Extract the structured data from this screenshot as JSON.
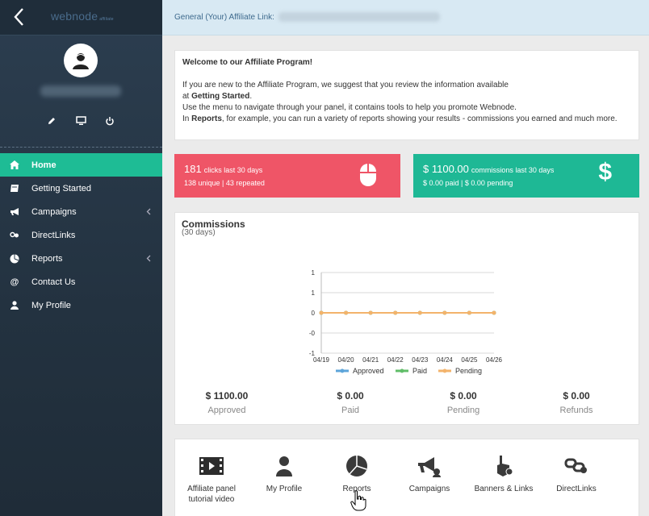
{
  "sidebar": {
    "logo": "webnode",
    "logo_sub": "affiliate",
    "items": [
      {
        "label": "Home",
        "icon": "home-icon",
        "active": true
      },
      {
        "label": "Getting Started",
        "icon": "book-icon"
      },
      {
        "label": "Campaigns",
        "icon": "bullhorn-icon",
        "submenu": true
      },
      {
        "label": "DirectLinks",
        "icon": "link-icon"
      },
      {
        "label": "Reports",
        "icon": "pie-chart-icon",
        "submenu": true
      },
      {
        "label": "Contact Us",
        "icon": "at-icon"
      },
      {
        "label": "My Profile",
        "icon": "user-icon"
      }
    ]
  },
  "header": {
    "affiliate_link_label": "General (Your) Affiliate Link:"
  },
  "welcome": {
    "title": "Welcome to our Affiliate Program!",
    "line1": "If you are new to the Affiliate Program, we suggest that you review the information available",
    "line2_prefix": "at ",
    "line2_bold": "Getting Started",
    "line2_suffix": ".",
    "line3": "Use the menu to navigate through your panel, it contains tools to help you promote Webnode.",
    "line4_prefix": "In ",
    "line4_bold": "Reports",
    "line4_suffix": ", for example, you can run a variety of reports showing your results - commissions you earned and much more."
  },
  "stats": {
    "clicks": {
      "value": "181",
      "label": "clicks last 30 days",
      "sub": "138 unique | 43 repeated",
      "color": "#ef5567"
    },
    "commissions": {
      "value": "$ 1100.00",
      "label": "commissions last 30 days",
      "sub": "$ 0.00 paid | $ 0.00 pending",
      "color": "#1eb895"
    }
  },
  "commissions": {
    "title": "Commissions",
    "subtitle": "(30 days)",
    "totals": [
      {
        "value": "$ 1100.00",
        "label": "Approved"
      },
      {
        "value": "$ 0.00",
        "label": "Paid"
      },
      {
        "value": "$ 0.00",
        "label": "Pending"
      },
      {
        "value": "$ 0.00",
        "label": "Refunds"
      }
    ]
  },
  "chart_data": {
    "type": "line",
    "categories": [
      "04/19",
      "04/20",
      "04/21",
      "04/22",
      "04/23",
      "04/24",
      "04/25",
      "04/26"
    ],
    "ylim": [
      -1,
      1
    ],
    "yticks": [
      "1",
      "1",
      "0",
      "-0",
      "-1"
    ],
    "series": [
      {
        "name": "Approved",
        "values": [
          0,
          0,
          0,
          0,
          0,
          0,
          0,
          0
        ],
        "color": "#5da5da"
      },
      {
        "name": "Paid",
        "values": [
          0,
          0,
          0,
          0,
          0,
          0,
          0,
          0
        ],
        "color": "#60bd68"
      },
      {
        "name": "Pending",
        "values": [
          0,
          0,
          0,
          0,
          0,
          0,
          0,
          0
        ],
        "color": "#f3b36b"
      }
    ],
    "legend": "bottom",
    "grid": true
  },
  "shortcuts": [
    {
      "label": "Affiliate panel tutorial video",
      "icon": "video-icon"
    },
    {
      "label": "My Profile",
      "icon": "user-icon"
    },
    {
      "label": "Reports",
      "icon": "pie-chart-icon"
    },
    {
      "label": "Campaigns",
      "icon": "bullhorn-icon"
    },
    {
      "label": "Banners & Links",
      "icon": "hand-pointer-icon"
    },
    {
      "label": "DirectLinks",
      "icon": "link-icon"
    }
  ]
}
